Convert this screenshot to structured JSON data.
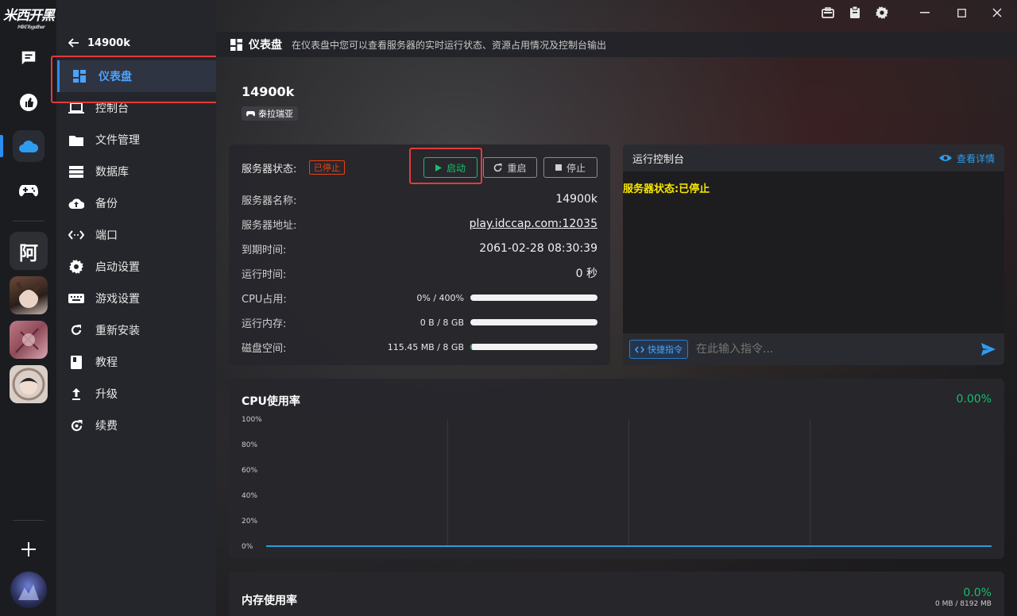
{
  "app": {
    "logo_text": "米西开黑",
    "logo_sub": "MiXi Together"
  },
  "rail": {
    "items": [
      {
        "icon": "chat-icon"
      },
      {
        "icon": "thumb-up-icon"
      },
      {
        "icon": "cloud-icon"
      },
      {
        "icon": "gamepad-icon"
      }
    ],
    "server_char": "阿",
    "add_icon": "plus-icon"
  },
  "sidebar": {
    "back_label": "14900k",
    "items": [
      {
        "label": "仪表盘",
        "icon": "dashboard-icon"
      },
      {
        "label": "控制台",
        "icon": "laptop-icon"
      },
      {
        "label": "文件管理",
        "icon": "folder-icon"
      },
      {
        "label": "数据库",
        "icon": "database-icon"
      },
      {
        "label": "备份",
        "icon": "cloud-upload-icon"
      },
      {
        "label": "端口",
        "icon": "port-icon"
      },
      {
        "label": "启动设置",
        "icon": "gear-icon"
      },
      {
        "label": "游戏设置",
        "icon": "keyboard-icon"
      },
      {
        "label": "重新安装",
        "icon": "refresh-icon"
      },
      {
        "label": "教程",
        "icon": "book-icon"
      },
      {
        "label": "升级",
        "icon": "upgrade-icon"
      },
      {
        "label": "续费",
        "icon": "renew-icon"
      }
    ]
  },
  "header": {
    "title": "仪表盘",
    "desc": "在仪表盘中您可以查看服务器的实时运行状态、资源占用情况及控制台输出"
  },
  "server": {
    "name": "14900k",
    "game_tag": "泰拉瑞亚"
  },
  "status_card": {
    "status_label": "服务器状态:",
    "status_badge": "已停止",
    "start_label": "启动",
    "restart_label": "重启",
    "stop_label": "停止",
    "rows": [
      {
        "label": "服务器名称:",
        "value": "14900k"
      },
      {
        "label": "服务器地址:",
        "value": "play.idccap.com:12035"
      },
      {
        "label": "到期时间:",
        "value": "2061-02-28 08:30:39"
      },
      {
        "label": "运行时间:",
        "value": "0 秒"
      }
    ],
    "usage": [
      {
        "label": "CPU占用:",
        "value": "0% / 400%",
        "fraction": 0
      },
      {
        "label": "运行内存:",
        "value": "0 B / 8 GB",
        "fraction": 0
      },
      {
        "label": "磁盘空间:",
        "value": "115.45 MB / 8 GB",
        "fraction": 0.014
      }
    ]
  },
  "console": {
    "title": "运行控制台",
    "details_label": "查看详情",
    "output_line": "服务器状态:已停止",
    "quick_cmd_label": "快捷指令",
    "input_placeholder": "在此输入指令..."
  },
  "cpu_chart": {
    "title": "CPU使用率",
    "value": "0.00%"
  },
  "mem_chart": {
    "title": "内存使用率",
    "value": "0.0%",
    "sub": "0 MB / 8192 MB"
  },
  "chart_data": {
    "type": "line",
    "title": "CPU使用率",
    "y_ticks": [
      "100%",
      "80%",
      "60%",
      "40%",
      "20%",
      "0%"
    ],
    "ylim": [
      0,
      100
    ],
    "series": [
      {
        "values": [
          0,
          0,
          0,
          0,
          0
        ]
      }
    ],
    "grid": true,
    "colors": {
      "line": "#2d9cdb"
    }
  },
  "colors": {
    "accent": "#2d8cf0",
    "success": "#19be6b",
    "danger": "#ed4014",
    "warn_text": "#f7e600"
  }
}
